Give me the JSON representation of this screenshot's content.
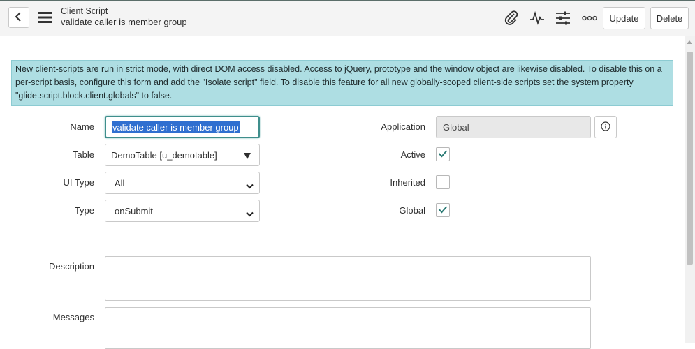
{
  "header": {
    "record_type": "Client Script",
    "record_name": "validate caller is member group",
    "update_label": "Update",
    "delete_label": "Delete",
    "icons": [
      "back-icon",
      "hamburger-menu-icon",
      "attachment-icon",
      "activity-icon",
      "settings-sliders-icon",
      "more-options-icon"
    ]
  },
  "banner": {
    "text": "New client-scripts are run in strict mode, with direct DOM access disabled. Access to jQuery, prototype and the window object are likewise disabled. To disable this on a per-script basis, configure this form and add the \"Isolate script\" field. To disable this feature for all new globally-scoped client-side scripts set the system property \"glide.script.block.client.globals\" to false."
  },
  "form": {
    "name_label": "Name",
    "name_value": "validate caller is member group",
    "table_label": "Table",
    "table_value": "DemoTable [u_demotable]",
    "ui_type_label": "UI Type",
    "ui_type_value": "All",
    "type_label": "Type",
    "type_value": "onSubmit",
    "application_label": "Application",
    "application_value": "Global",
    "active_label": "Active",
    "active_checked": true,
    "inherited_label": "Inherited",
    "inherited_checked": false,
    "global_label": "Global",
    "global_checked": true,
    "description_label": "Description",
    "messages_label": "Messages"
  },
  "colors": {
    "banner_bg": "#aedee3",
    "focus_border": "#3f8e8c",
    "selection": "#2f6fd0",
    "check": "#2a7a74"
  }
}
